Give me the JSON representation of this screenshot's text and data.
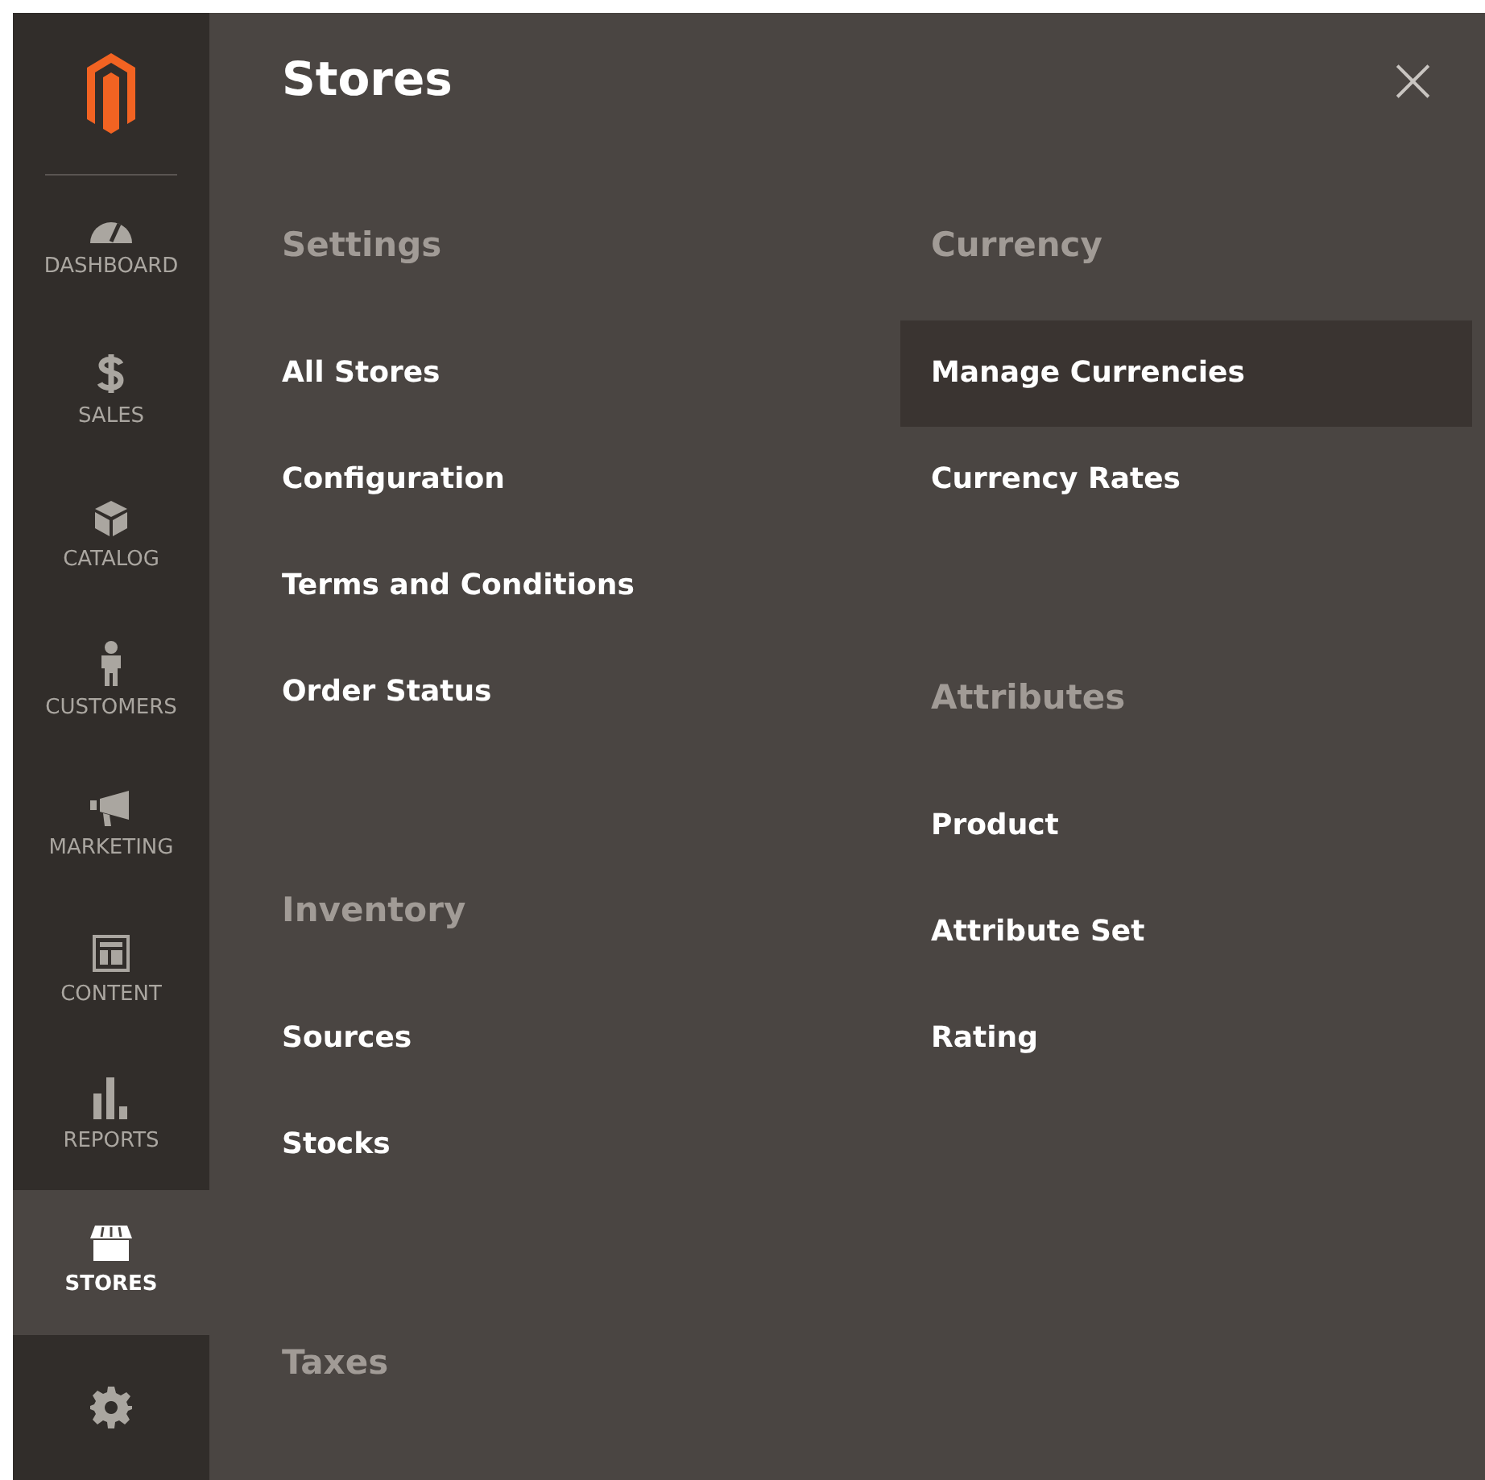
{
  "sidebar": {
    "items": [
      {
        "label": "DASHBOARD",
        "selected": false
      },
      {
        "label": "SALES",
        "selected": false
      },
      {
        "label": "CATALOG",
        "selected": false
      },
      {
        "label": "CUSTOMERS",
        "selected": false
      },
      {
        "label": "MARKETING",
        "selected": false
      },
      {
        "label": "CONTENT",
        "selected": false
      },
      {
        "label": "REPORTS",
        "selected": false
      },
      {
        "label": "STORES",
        "selected": true
      },
      {
        "selected": false
      }
    ]
  },
  "panel": {
    "title": "Stores",
    "close": "×",
    "columns": [
      [
        {
          "heading": "Settings",
          "items": [
            {
              "label": "All Stores",
              "selected": false
            },
            {
              "label": "Configuration",
              "selected": false
            },
            {
              "label": "Terms and Conditions",
              "selected": false
            },
            {
              "label": "Order Status",
              "selected": false
            }
          ]
        },
        {
          "heading": "Inventory",
          "items": [
            {
              "label": "Sources",
              "selected": false
            },
            {
              "label": "Stocks",
              "selected": false
            }
          ]
        },
        {
          "heading": "Taxes"
        }
      ],
      [
        {
          "heading": "Currency",
          "items": [
            {
              "label": "Manage Currencies",
              "selected": true
            },
            {
              "label": "Currency Rates",
              "selected": false
            }
          ]
        },
        {
          "heading": "Attributes",
          "items": [
            {
              "label": "Product",
              "selected": false
            },
            {
              "label": "Attribute Set",
              "selected": false
            },
            {
              "label": "Rating",
              "selected": false
            }
          ]
        }
      ]
    ]
  }
}
